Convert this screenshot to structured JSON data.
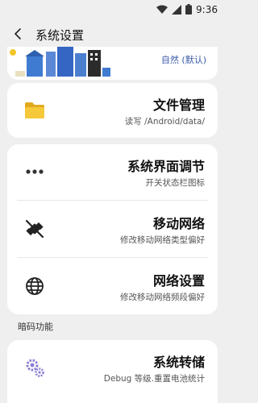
{
  "status_bar": {
    "time": "9:36",
    "icons": [
      "wifi-icon",
      "signal-icon",
      "battery-icon"
    ]
  },
  "app_bar": {
    "back_icon": "chevron-left-icon",
    "title": "系统设置"
  },
  "theme": {
    "label": "自然 (默认)"
  },
  "file_management": {
    "title": "文件管理",
    "subtitle": "读写 /Android/data/",
    "icon": "folder-icon"
  },
  "system_group": {
    "items": [
      {
        "title": "系统界面调节",
        "subtitle": "开关状态栏图标",
        "icon": "dots-icon"
      },
      {
        "title": "移动网络",
        "subtitle": "修改移动网络类型偏好",
        "icon": "satellite-off-icon"
      },
      {
        "title": "网络设置",
        "subtitle": "修改移动网络频段偏好",
        "icon": "globe-icon"
      }
    ]
  },
  "hidden_section": {
    "header": "暗码功能",
    "items": [
      {
        "title": "系统转储",
        "subtitle": "Debug 等级.重置电池统计",
        "icon": "gears-icon"
      }
    ]
  },
  "colors": {
    "background": "#efefef",
    "card": "#ffffff",
    "accent": "#3b5aa8",
    "folder": "#f3c62a"
  }
}
